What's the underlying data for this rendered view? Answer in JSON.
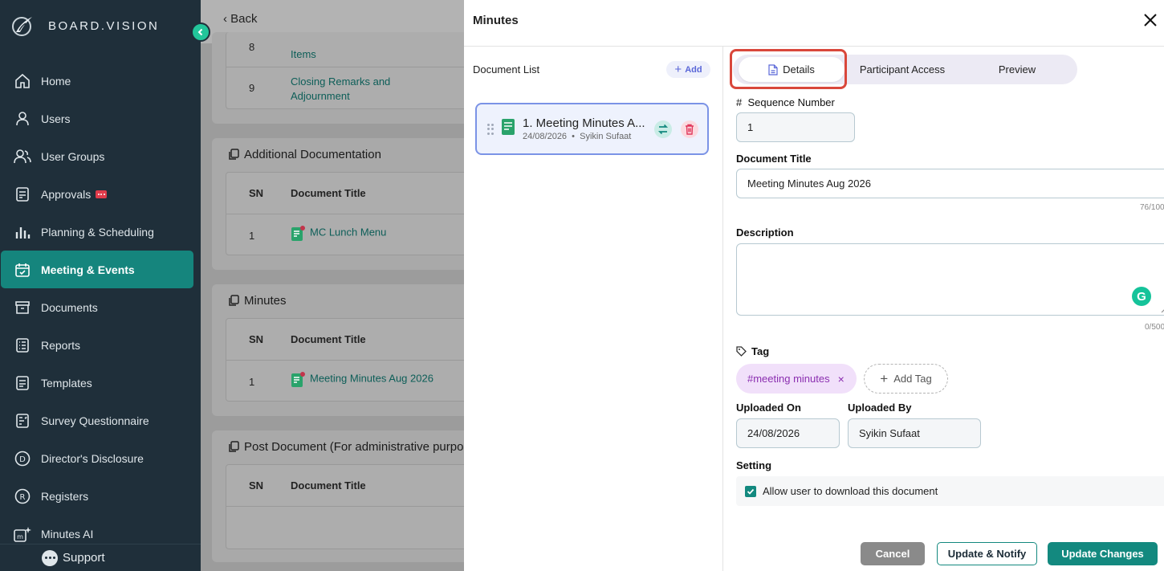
{
  "brand": {
    "name": "BOARD.VISION"
  },
  "sidebar": {
    "items": [
      {
        "label": "Home",
        "icon": "home-icon"
      },
      {
        "label": "Users",
        "icon": "user-icon"
      },
      {
        "label": "User Groups",
        "icon": "user-group-icon"
      },
      {
        "label": "Approvals",
        "icon": "approvals-icon"
      },
      {
        "label": "Planning & Scheduling",
        "icon": "chart-icon"
      },
      {
        "label": "Meeting & Events",
        "icon": "calendar-check-icon"
      },
      {
        "label": "Documents",
        "icon": "archive-icon"
      },
      {
        "label": "Reports",
        "icon": "report-icon"
      },
      {
        "label": "Templates",
        "icon": "template-icon"
      },
      {
        "label": "Survey Questionnaire",
        "icon": "survey-icon"
      },
      {
        "label": "Director's Disclosure",
        "icon": "d-circle-icon"
      },
      {
        "label": "Registers",
        "icon": "r-circle-icon"
      },
      {
        "label": "Minutes AI",
        "icon": "minutes-ai-icon"
      }
    ],
    "active": "Meeting & Events",
    "support_label": "Support"
  },
  "main": {
    "back_label": "Back",
    "agenda_rows": [
      {
        "sn": "8",
        "title": "Items"
      },
      {
        "sn": "9",
        "title": "Closing Remarks and Adjournment"
      }
    ],
    "sections": [
      {
        "title": "Additional Documentation",
        "col_sn": "SN",
        "col_title": "Document Title",
        "rows": [
          {
            "sn": "1",
            "title": "MC Lunch Menu"
          }
        ]
      },
      {
        "title": "Minutes",
        "col_sn": "SN",
        "col_title": "Document Title",
        "rows": [
          {
            "sn": "1",
            "title": "Meeting Minutes Aug 2026"
          }
        ]
      },
      {
        "title": "Post Document (For administrative purpos",
        "col_sn": "SN",
        "col_title": "Document Title",
        "rows": []
      }
    ]
  },
  "panel": {
    "title": "Minutes",
    "document_list_label": "Document List",
    "add_label": "Add",
    "doc_card": {
      "title": "1. Meeting Minutes A...",
      "date": "24/08/2026",
      "author": "Syikin Sufaat"
    },
    "tabs": [
      "Details",
      "Participant Access",
      "Preview"
    ],
    "active_tab": "Details",
    "form": {
      "sequence_label": "Sequence Number",
      "sequence_value": "1",
      "title_label": "Document Title",
      "title_value": "Meeting Minutes Aug 2026",
      "title_counter": "76/100",
      "description_label": "Description",
      "description_counter": "0/500",
      "tag_label": "Tag",
      "tag_value": "#meeting minutes",
      "add_tag_label": "Add Tag",
      "uploaded_on_label": "Uploaded On",
      "uploaded_on_value": "24/08/2026",
      "uploaded_by_label": "Uploaded By",
      "uploaded_by_value": "Syikin Sufaat",
      "setting_label": "Setting",
      "download_label": "Allow user to download this document",
      "download_checked": true
    },
    "buttons": {
      "cancel": "Cancel",
      "notify": "Update & Notify",
      "update": "Update Changes"
    }
  },
  "colors": {
    "accent": "#13897f",
    "sidebar_bg": "#1f2f3a",
    "highlight": "#d9473b",
    "tag_bg": "#f1e0fa"
  }
}
